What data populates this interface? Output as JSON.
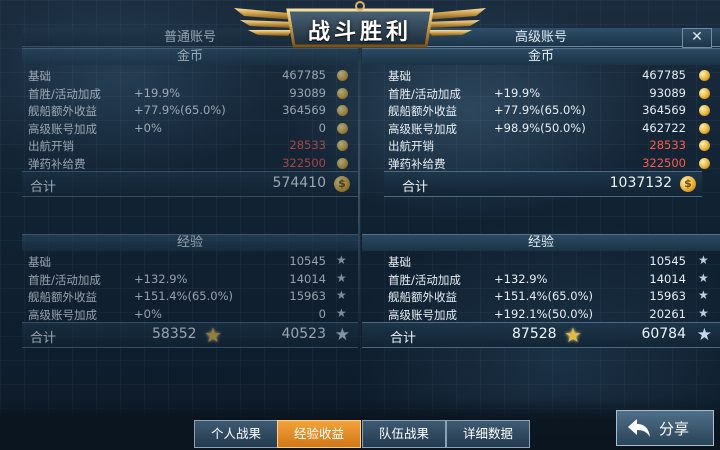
{
  "title": "战斗胜利",
  "close_label": "✕",
  "normal": {
    "header": "普通账号",
    "gold_title": "金币",
    "gold_rows": [
      {
        "label": "基础",
        "bonus": "",
        "value": "467785",
        "red": false
      },
      {
        "label": "首胜/活动加成",
        "bonus": "+19.9%",
        "value": "93089",
        "red": false
      },
      {
        "label": "舰船额外收益",
        "bonus": "+77.9%(65.0%)",
        "value": "364569",
        "red": false
      },
      {
        "label": "高级账号加成",
        "bonus": "+0%",
        "value": "0",
        "red": false
      },
      {
        "label": "出航开销",
        "bonus": "",
        "value": "28533",
        "red": true
      },
      {
        "label": "弹药补给费",
        "bonus": "",
        "value": "322500",
        "red": true
      }
    ],
    "gold_total_label": "合计",
    "gold_total": "574410",
    "exp_title": "经验",
    "exp_rows": [
      {
        "label": "基础",
        "bonus": "",
        "value": "10545"
      },
      {
        "label": "首胜/活动加成",
        "bonus": "+132.9%",
        "value": "14014"
      },
      {
        "label": "舰船额外收益",
        "bonus": "+151.4%(65.0%)",
        "value": "15963"
      },
      {
        "label": "高级账号加成",
        "bonus": "+0%",
        "value": "0"
      }
    ],
    "exp_total_label": "合计",
    "exp_total_gold": "58352",
    "exp_total_blue": "40523"
  },
  "premium": {
    "header": "高级账号",
    "gold_title": "金币",
    "gold_rows": [
      {
        "label": "基础",
        "bonus": "",
        "value": "467785",
        "red": false
      },
      {
        "label": "首胜/活动加成",
        "bonus": "+19.9%",
        "value": "93089",
        "red": false
      },
      {
        "label": "舰船额外收益",
        "bonus": "+77.9%(65.0%)",
        "value": "364569",
        "red": false
      },
      {
        "label": "高级账号加成",
        "bonus": "+98.9%(50.0%)",
        "value": "462722",
        "red": false
      },
      {
        "label": "出航开销",
        "bonus": "",
        "value": "28533",
        "red": true
      },
      {
        "label": "弹药补给费",
        "bonus": "",
        "value": "322500",
        "red": true
      }
    ],
    "gold_total_label": "合计",
    "gold_total": "1037132",
    "exp_title": "经验",
    "exp_rows": [
      {
        "label": "基础",
        "bonus": "",
        "value": "10545"
      },
      {
        "label": "首胜/活动加成",
        "bonus": "+132.9%",
        "value": "14014"
      },
      {
        "label": "舰船额外收益",
        "bonus": "+151.4%(65.0%)",
        "value": "15963"
      },
      {
        "label": "高级账号加成",
        "bonus": "+192.1%(50.0%)",
        "value": "20261"
      }
    ],
    "exp_total_label": "合计",
    "exp_total_gold": "87528",
    "exp_total_blue": "60784"
  },
  "tabs": [
    {
      "label": "个人战果",
      "active": false
    },
    {
      "label": "经验收益",
      "active": true
    },
    {
      "label": "队伍战果",
      "active": false
    },
    {
      "label": "详细数据",
      "active": false
    }
  ],
  "share_label": "分享",
  "colors": {
    "negative": "#ff5a4a",
    "active_tab": "#f3a33a",
    "gold_star": "#e7b93d"
  }
}
